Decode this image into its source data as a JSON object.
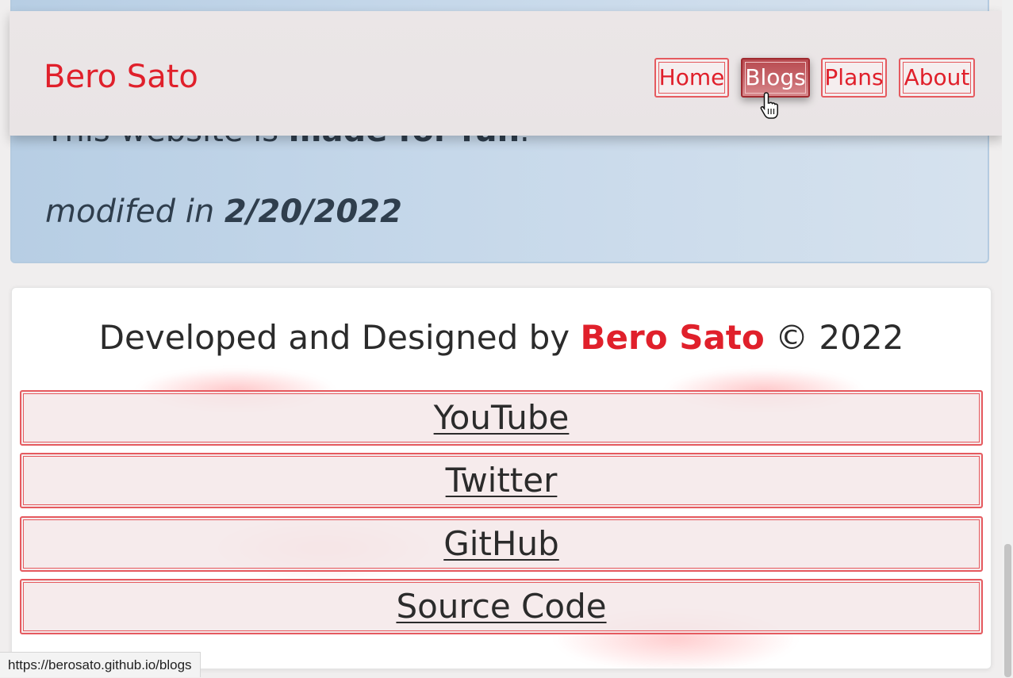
{
  "info": {
    "line1_prefix": "This website is ",
    "line1_bold": "made for fun",
    "line1_suffix": ".",
    "modified_prefix": "modifed in ",
    "modified_date": "2/20/2022"
  },
  "header": {
    "brand": "Bero Sato",
    "nav": [
      "Home",
      "Blogs",
      "Plans",
      "About"
    ],
    "active_nav": "Blogs"
  },
  "footer": {
    "credit_prefix": "Developed and Designed by ",
    "credit_name": "Bero Sato",
    "credit_suffix": " © 2022",
    "links": [
      "YouTube",
      "Twitter",
      "GitHub",
      "Source Code"
    ]
  },
  "status_bar": {
    "url": "https://berosato.github.io/blogs"
  },
  "colors": {
    "brand": "#e0202b",
    "accent_border": "#e55a5f",
    "active_button": "#b84a50",
    "info_card": "#c6d8ea"
  },
  "icons": {
    "cursor": "hand-pointer-icon"
  }
}
